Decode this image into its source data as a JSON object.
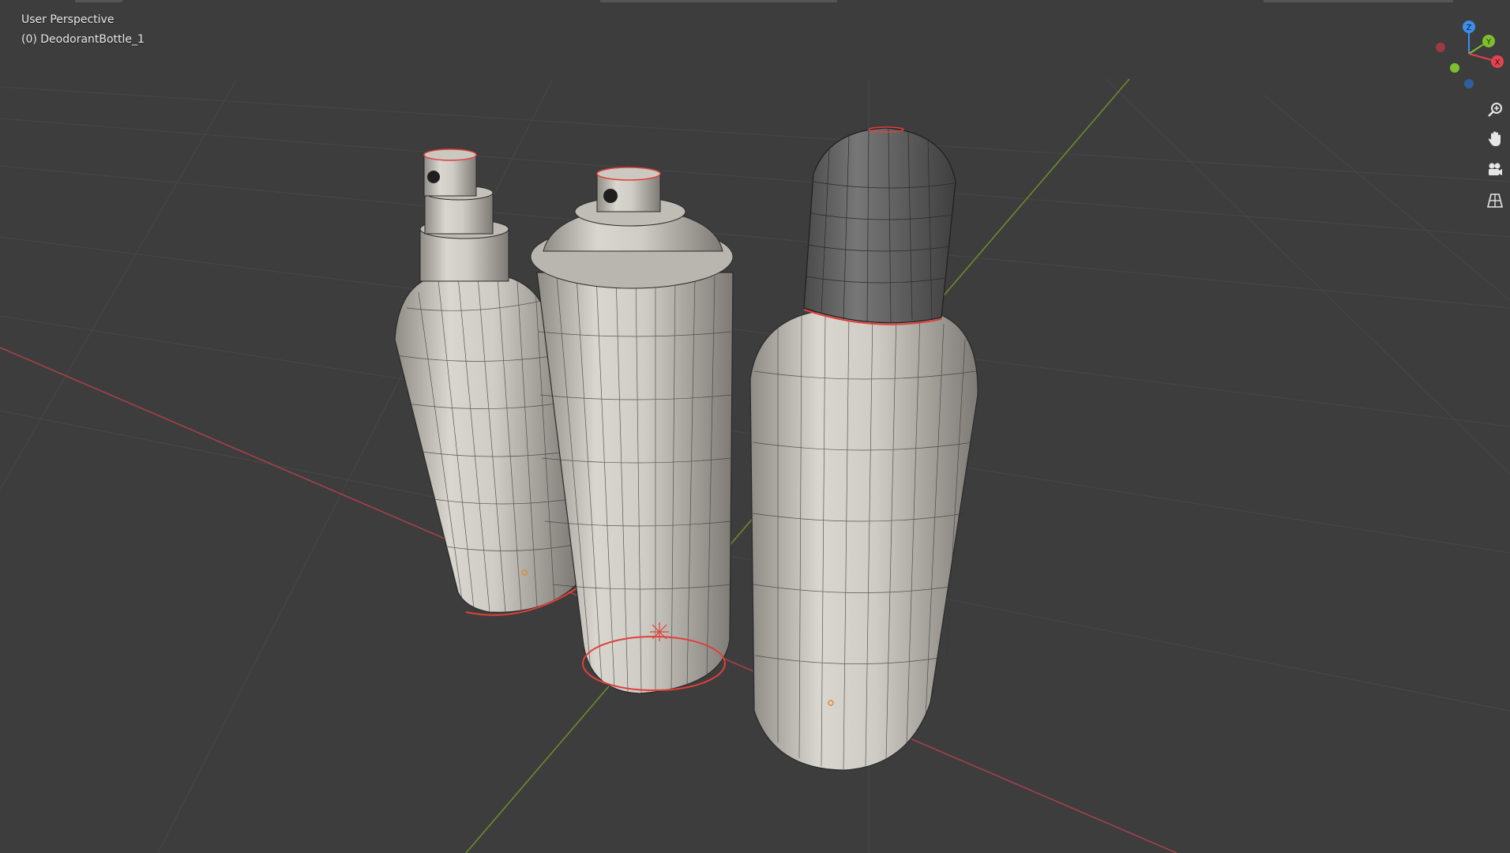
{
  "viewport": {
    "view_name": "User Perspective",
    "object_info": "(0) DeodorantBottle_1"
  },
  "gizmo": {
    "z_label": "Z",
    "y_label": "Y",
    "x_label": "X"
  },
  "navigation": [
    {
      "name": "zoom-icon"
    },
    {
      "name": "pan-hand-icon"
    },
    {
      "name": "camera-icon"
    },
    {
      "name": "grid-perspective-icon"
    }
  ],
  "scene": {
    "objects": [
      "spray-bottle",
      "spray-can",
      "deodorant-bottle"
    ]
  },
  "colors": {
    "background": "#3d3d3d",
    "grid_line": "#4a4a4a",
    "x_axis": "#a4414a",
    "y_axis": "#6b8a2e",
    "mesh_body": "#c9c6bf",
    "wire": "#2a2a2a",
    "selected_edge": "#e0403a",
    "gizmo_x": "#e1434f",
    "gizmo_y": "#7fbf2e",
    "gizmo_z": "#3b8fea"
  }
}
